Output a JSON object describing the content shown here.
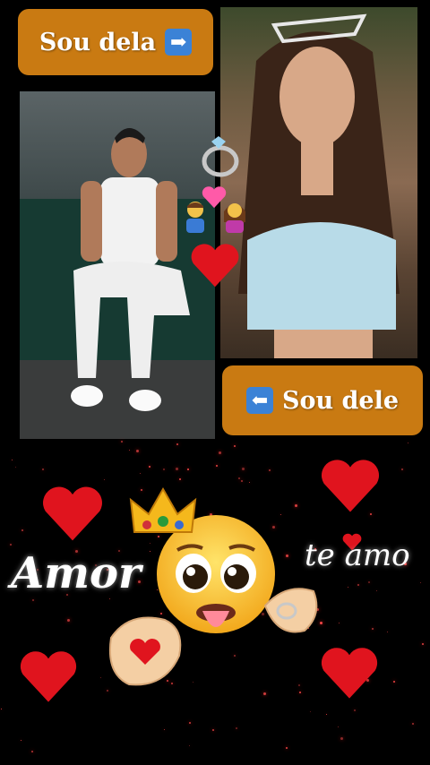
{
  "labels": {
    "sou_dela": "Sou dela",
    "sou_dele": "Sou dele",
    "amor": "Amor",
    "te_amo": "te amo"
  },
  "icons": {
    "right_arrow": "➡",
    "left_arrow": "⬅"
  },
  "colors": {
    "pill": "#c97a12",
    "arrow_box": "#3b82d6",
    "heart": "#e0141e",
    "background": "#000000"
  }
}
